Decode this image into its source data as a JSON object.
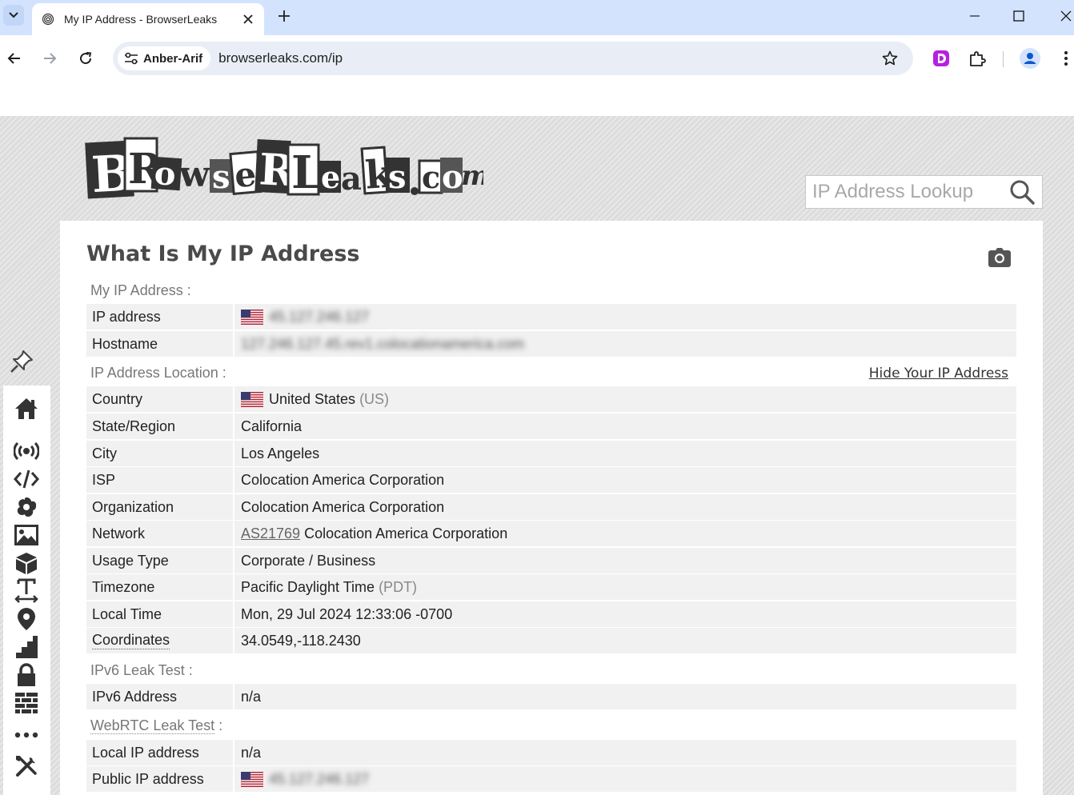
{
  "browser": {
    "tab_title": "My IP Address - BrowserLeaks",
    "profile_chip": "Anber-Arif",
    "url": "browserleaks.com/ip"
  },
  "site": {
    "logo_text": "BrowserLeaks.com",
    "search_placeholder": "IP Address Lookup",
    "page_title": "What Is My IP Address",
    "hide_ip_link": "Hide Your IP Address"
  },
  "sections": {
    "my_ip": {
      "label": "My IP Address :",
      "rows": [
        {
          "key": "IP address",
          "value": "45.127.246.127"
        },
        {
          "key": "Hostname",
          "value": "127.246.127.45.rev1.colocationamerica.com"
        }
      ]
    },
    "location": {
      "label": "IP Address Location :",
      "rows": [
        {
          "key": "Country",
          "value": "United States",
          "extra": "(US)"
        },
        {
          "key": "State/Region",
          "value": "California"
        },
        {
          "key": "City",
          "value": "Los Angeles"
        },
        {
          "key": "ISP",
          "value": "Colocation America Corporation"
        },
        {
          "key": "Organization",
          "value": "Colocation America Corporation"
        },
        {
          "key": "Network",
          "link": "AS21769",
          "value": "Colocation America Corporation"
        },
        {
          "key": "Usage Type",
          "value": "Corporate / Business"
        },
        {
          "key": "Timezone",
          "value": "Pacific Daylight Time",
          "extra": "(PDT)"
        },
        {
          "key": "Local Time",
          "value": "Mon, 29 Jul 2024 12:33:06 -0700"
        },
        {
          "key": "Coordinates",
          "value": "34.0549,-118.2430"
        }
      ]
    },
    "ipv6": {
      "label": "IPv6 Leak Test :",
      "rows": [
        {
          "key": "IPv6 Address",
          "value": "n/a"
        }
      ]
    },
    "webrtc": {
      "label_text": "WebRTC Leak Test",
      "label_suffix": " :",
      "rows": [
        {
          "key": "Local IP address",
          "value": "n/a"
        },
        {
          "key": "Public IP address",
          "value": "45.127.246.127"
        }
      ]
    }
  },
  "sidebar_icons": [
    "home-icon",
    "broadcast-icon",
    "code-icon",
    "flower-icon",
    "image-icon",
    "cube-icon",
    "text-height-icon",
    "map-pin-icon",
    "stairs-icon",
    "lock-icon",
    "firewall-icon",
    "more-dots-icon",
    "tools-icon"
  ],
  "colors": {
    "tabbar_bg": "#d3e3fd",
    "omnibox_bg": "#e9eef6",
    "row_bg": "#f1f1f1",
    "page_bg": "#dcdcdc"
  }
}
